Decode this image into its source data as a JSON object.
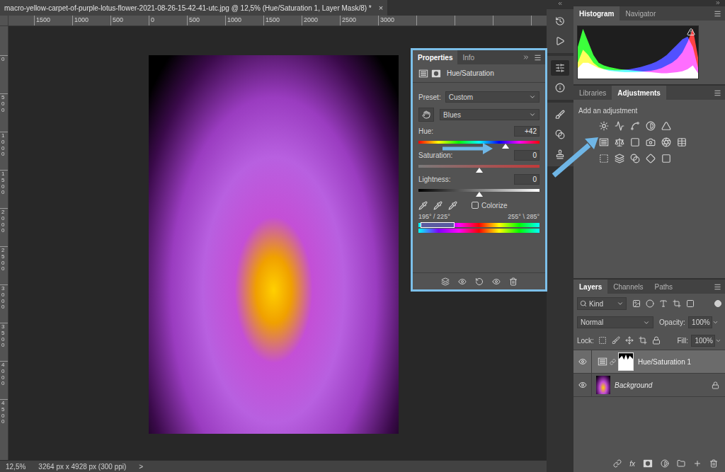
{
  "document": {
    "title": "macro-yellow-carpet-of-purple-lotus-flower-2021-08-26-15-42-41-utc.jpg @ 12,5% (Hue/Saturation 1, Layer Mask/8) *",
    "close": "×"
  },
  "rulers": {
    "horizontal": [
      "1500",
      "1000",
      "500",
      "0",
      "500",
      "1000",
      "1500",
      "2000",
      "2500",
      "3000"
    ],
    "vertical": [
      "0",
      "500",
      "1000",
      "1500",
      "2000",
      "2500",
      "3000",
      "3500",
      "4000",
      "4500"
    ]
  },
  "properties": {
    "tabs": [
      {
        "label": "Properties",
        "selected": true
      },
      {
        "label": "Info",
        "selected": false
      }
    ],
    "title": "Hue/Saturation",
    "preset": {
      "label": "Preset:",
      "value": "Custom"
    },
    "channel": {
      "value": "Blues"
    },
    "sliders": [
      {
        "kind": "hue",
        "label": "Hue:",
        "value": "+42",
        "level": 0.72
      },
      {
        "kind": "saturation",
        "label": "Saturation:",
        "value": "0",
        "level": 0.5
      },
      {
        "kind": "lightness",
        "label": "Lightness:",
        "value": "0",
        "level": 0.5
      }
    ],
    "colorize": {
      "label": "Colorize",
      "checked": false
    },
    "range": {
      "left": "195° / 225°",
      "right": "255° \\ 285°",
      "from": 0.02,
      "to": 0.3
    }
  },
  "tool_strip": {
    "groups": [
      [
        {
          "kind": "history",
          "selected": false
        },
        {
          "kind": "actions",
          "selected": false
        }
      ],
      [
        {
          "kind": "properties",
          "selected": true
        },
        {
          "kind": "info",
          "selected": false
        }
      ],
      [
        {
          "kind": "brushes",
          "selected": false
        },
        {
          "kind": "brush-settings",
          "selected": false
        },
        {
          "kind": "clone-source",
          "selected": false
        }
      ]
    ]
  },
  "histogram": {
    "tabs": [
      {
        "label": "Histogram",
        "selected": true
      },
      {
        "label": "Navigator",
        "selected": false
      }
    ],
    "warning": true,
    "series": [
      {
        "color": "#ff2a2a",
        "values": [
          30,
          55,
          45,
          30,
          22,
          18,
          15,
          14,
          13,
          12,
          12,
          12,
          13,
          14,
          15,
          17,
          20,
          25,
          30,
          38,
          50,
          70,
          95,
          40
        ]
      },
      {
        "color": "#22ff22",
        "values": [
          60,
          95,
          70,
          45,
          30,
          25,
          22,
          20,
          18,
          17,
          16,
          15,
          14,
          13,
          12,
          11,
          10,
          10,
          11,
          12,
          14,
          18,
          25,
          10
        ]
      },
      {
        "color": "#3a3aff",
        "values": [
          20,
          30,
          30,
          25,
          20,
          18,
          17,
          16,
          16,
          17,
          18,
          20,
          22,
          25,
          28,
          32,
          38,
          45,
          55,
          65,
          75,
          80,
          60,
          20
        ]
      }
    ]
  },
  "adjustments": {
    "tabs": [
      {
        "label": "Libraries",
        "selected": false
      },
      {
        "label": "Adjustments",
        "selected": true
      }
    ],
    "hint": "Add an adjustment"
  },
  "layers": {
    "tabs": [
      {
        "label": "Layers",
        "selected": true
      },
      {
        "label": "Channels",
        "selected": false
      },
      {
        "label": "Paths",
        "selected": false
      }
    ],
    "filter": "Kind",
    "blend_mode": "Normal",
    "opacity": {
      "label": "Opacity:",
      "value": "100%"
    },
    "lock_label": "Lock:",
    "fill": {
      "label": "Fill:",
      "value": "100%"
    },
    "items": [
      {
        "name": "Hue/Saturation 1",
        "kind": "adjustment",
        "selected": true,
        "visible": true,
        "locked": false
      },
      {
        "name": "Background",
        "kind": "image",
        "selected": false,
        "visible": true,
        "locked": true
      }
    ],
    "fx": "fx"
  },
  "status_bar": {
    "zoom": "12,5%",
    "size": "3264 px x 4928 px (300 ppi)",
    "more": ">"
  }
}
